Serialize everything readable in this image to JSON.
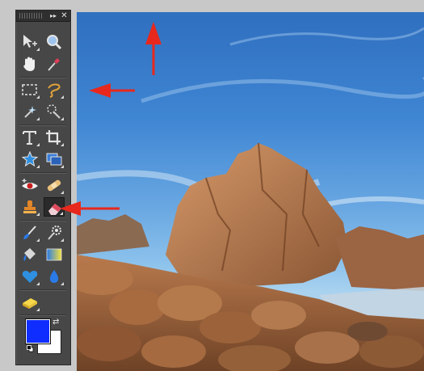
{
  "panel": {
    "collapse_glyph": "▸▸",
    "close_glyph": "✕",
    "tools": [
      {
        "id": "move-tool",
        "icon": "move-arrow-icon"
      },
      {
        "id": "zoom-tool",
        "icon": "magnifier-icon"
      },
      {
        "id": "hand-tool",
        "icon": "hand-icon"
      },
      {
        "id": "eyedropper-tool",
        "icon": "eyedropper-icon"
      },
      {
        "id": "marquee-tool",
        "icon": "rect-marquee-icon"
      },
      {
        "id": "lasso-tool",
        "icon": "lasso-icon"
      },
      {
        "id": "magic-wand-tool",
        "icon": "magic-wand-icon"
      },
      {
        "id": "quick-selection-tool",
        "icon": "quick-selection-icon"
      },
      {
        "id": "type-tool",
        "icon": "type-T-icon"
      },
      {
        "id": "crop-tool",
        "icon": "crop-icon"
      },
      {
        "id": "shape-tool",
        "icon": "star-shape-icon"
      },
      {
        "id": "recompose-tool",
        "icon": "recompose-icon"
      },
      {
        "id": "red-eye-tool",
        "icon": "red-eye-icon"
      },
      {
        "id": "healing-tool",
        "icon": "bandage-icon"
      },
      {
        "id": "clone-stamp-tool",
        "icon": "stamp-icon"
      },
      {
        "id": "eraser-tool",
        "icon": "eraser-icon",
        "selected": true
      },
      {
        "id": "brush-tool",
        "icon": "brush-icon"
      },
      {
        "id": "smart-brush-tool",
        "icon": "gear-brush-icon"
      },
      {
        "id": "paint-bucket-tool",
        "icon": "paint-bucket-icon"
      },
      {
        "id": "gradient-tool",
        "icon": "gradient-icon"
      },
      {
        "id": "blur-tool",
        "icon": "heart-blur-icon"
      },
      {
        "id": "sharpen-tool",
        "icon": "droplet-icon"
      },
      {
        "id": "sponge-tool",
        "icon": "sponge-icon"
      }
    ],
    "colors": {
      "foreground": "#0f2dff",
      "background": "#ffffff"
    }
  },
  "annotations": {
    "arrow_color": "#e8281c",
    "arrows": [
      "pointing-up-at-sky",
      "pointing-left-at-sky",
      "pointing-left-at-eraser"
    ]
  }
}
